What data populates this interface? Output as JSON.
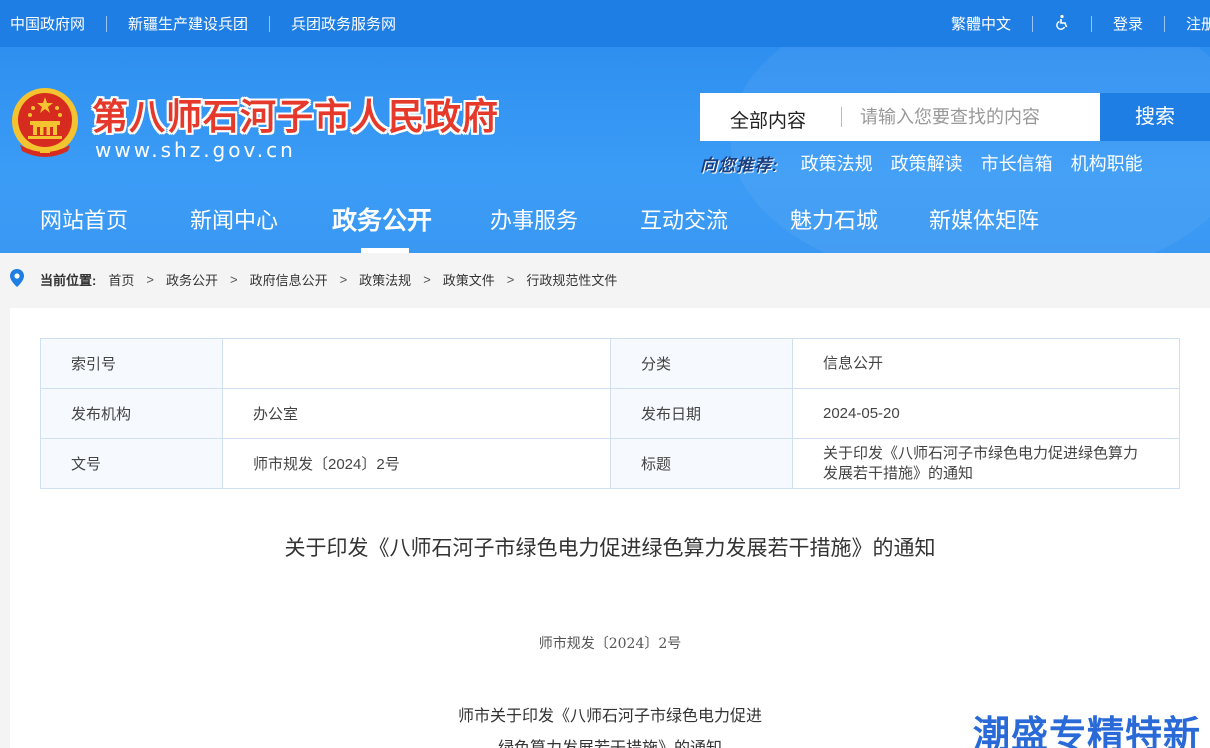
{
  "topbar": {
    "left_links": [
      "中国政府网",
      "新疆生产建设兵团",
      "兵团政务服务网"
    ],
    "lang": "繁體中文",
    "login": "登录",
    "register": "注册"
  },
  "header": {
    "site_title": "第八师石河子市人民政府",
    "site_url": "www.shz.gov.cn",
    "search_scope": "全部内容",
    "search_placeholder": "请输入您要查找的内容",
    "search_button": "搜索",
    "recommend_label": "向您推荐:",
    "recommend_links": [
      "政策法规",
      "政策解读",
      "市长信箱",
      "机构职能"
    ]
  },
  "nav": {
    "items": [
      "网站首页",
      "新闻中心",
      "政务公开",
      "办事服务",
      "互动交流",
      "魅力石城",
      "新媒体矩阵"
    ],
    "active": "政务公开"
  },
  "breadcrumb": {
    "label": "当前位置:",
    "items": [
      "首页",
      "政务公开",
      "政府信息公开",
      "政策法规",
      "政策文件",
      "行政规范性文件"
    ]
  },
  "meta": {
    "rows": [
      {
        "k1": "索引号",
        "v1": "",
        "k2": "分类",
        "v2": "信息公开"
      },
      {
        "k1": "发布机构",
        "v1": "办公室",
        "k2": "发布日期",
        "v2": "2024-05-20"
      },
      {
        "k1": "文号",
        "v1": "师市规发〔2024〕2号",
        "k2": "标题",
        "v2": "关于印发《八师石河子市绿色电力促进绿色算力发展若干措施》的通知"
      }
    ]
  },
  "document": {
    "title": "关于印发《八师石河子市绿色电力促进绿色算力发展若干措施》的通知",
    "number": "师市规发〔2024〕2号",
    "body_line1": "师市关于印发《八师石河子市绿色电力促进",
    "body_line2": "绿色算力发展若干措施》的通知"
  },
  "watermark": "潮盛专精特新",
  "colors": {
    "primary_blue": "#1f7ee3",
    "header_blue": "#3a98f3",
    "title_red": "#e53a2b"
  }
}
